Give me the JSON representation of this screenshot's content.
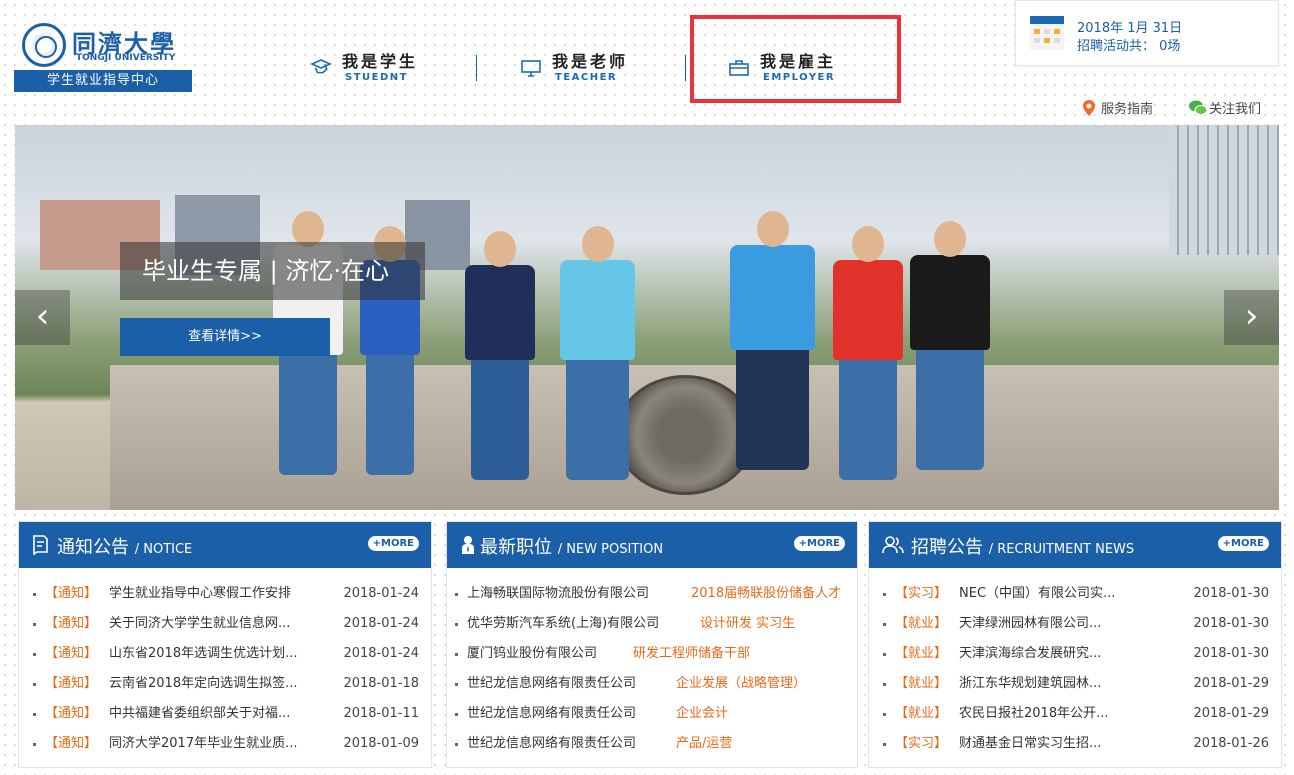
{
  "logo": {
    "cn": "同濟大學",
    "en": "TONGJI UNIVERSITY",
    "subtitle": "学生就业指导中心"
  },
  "roles": [
    {
      "cn": "我是学生",
      "en": "STUEDNT"
    },
    {
      "cn": "我是老师",
      "en": "TEACHER"
    },
    {
      "cn": "我是雇主",
      "en": "EMPLOYER"
    }
  ],
  "datebox": {
    "date": "2018年 1月 31日",
    "activities": "招聘活动共： 0场"
  },
  "links": {
    "guide": "服务指南",
    "follow": "关注我们"
  },
  "banner": {
    "title": "毕业生专属 | 济忆·在心",
    "button": "查看详情>>",
    "prev": "‹",
    "next": "›"
  },
  "notice": {
    "title": "通知公告",
    "subtitle": "/ NOTICE",
    "more": "+MORE",
    "items": [
      {
        "tag": "【通知】",
        "title": "学生就业指导中心寒假工作安排",
        "date": "2018-01-24"
      },
      {
        "tag": "【通知】",
        "title": "关于同济大学学生就业信息网...",
        "date": "2018-01-24"
      },
      {
        "tag": "【通知】",
        "title": "山东省2018年选调生优选计划...",
        "date": "2018-01-24"
      },
      {
        "tag": "【通知】",
        "title": "云南省2018年定向选调生拟签...",
        "date": "2018-01-18"
      },
      {
        "tag": "【通知】",
        "title": "中共福建省委组织部关于对福...",
        "date": "2018-01-11"
      },
      {
        "tag": "【通知】",
        "title": "同济大学2017年毕业生就业质...",
        "date": "2018-01-09"
      }
    ]
  },
  "positions": {
    "title": "最新职位",
    "subtitle": "/ NEW POSITION",
    "more": "+MORE",
    "items": [
      {
        "company": "上海畅联国际物流股份有限公司",
        "position": "2018届畅联股份储备人才"
      },
      {
        "company": "优华劳斯汽车系统(上海)有限公司",
        "position": "设计研发 实习生"
      },
      {
        "company": "厦门钨业股份有限公司",
        "position": "研发工程师储备干部"
      },
      {
        "company": "世纪龙信息网络有限责任公司",
        "position": "企业发展（战略管理）"
      },
      {
        "company": "世纪龙信息网络有限责任公司",
        "position": "企业会计"
      },
      {
        "company": "世纪龙信息网络有限责任公司",
        "position": "产品/运营"
      }
    ]
  },
  "recruit": {
    "title": "招聘公告",
    "subtitle": "/ RECRUITMENT NEWS",
    "more": "+MORE",
    "items": [
      {
        "tag": "【实习】",
        "title": "NEC（中国）有限公司实...",
        "date": "2018-01-30"
      },
      {
        "tag": "【就业】",
        "title": "天津绿洲园林有限公司...",
        "date": "2018-01-30"
      },
      {
        "tag": "【就业】",
        "title": "天津滨海综合发展研究...",
        "date": "2018-01-30"
      },
      {
        "tag": "【就业】",
        "title": "浙江东华规划建筑园林...",
        "date": "2018-01-29"
      },
      {
        "tag": "【就业】",
        "title": "农民日报社2018年公开...",
        "date": "2018-01-29"
      },
      {
        "tag": "【实习】",
        "title": "财通基金日常实习生招...",
        "date": "2018-01-26"
      }
    ]
  },
  "colors": {
    "brand": "#1b5fa8",
    "tag": "#e86a18",
    "highlight": "#e8333a"
  }
}
